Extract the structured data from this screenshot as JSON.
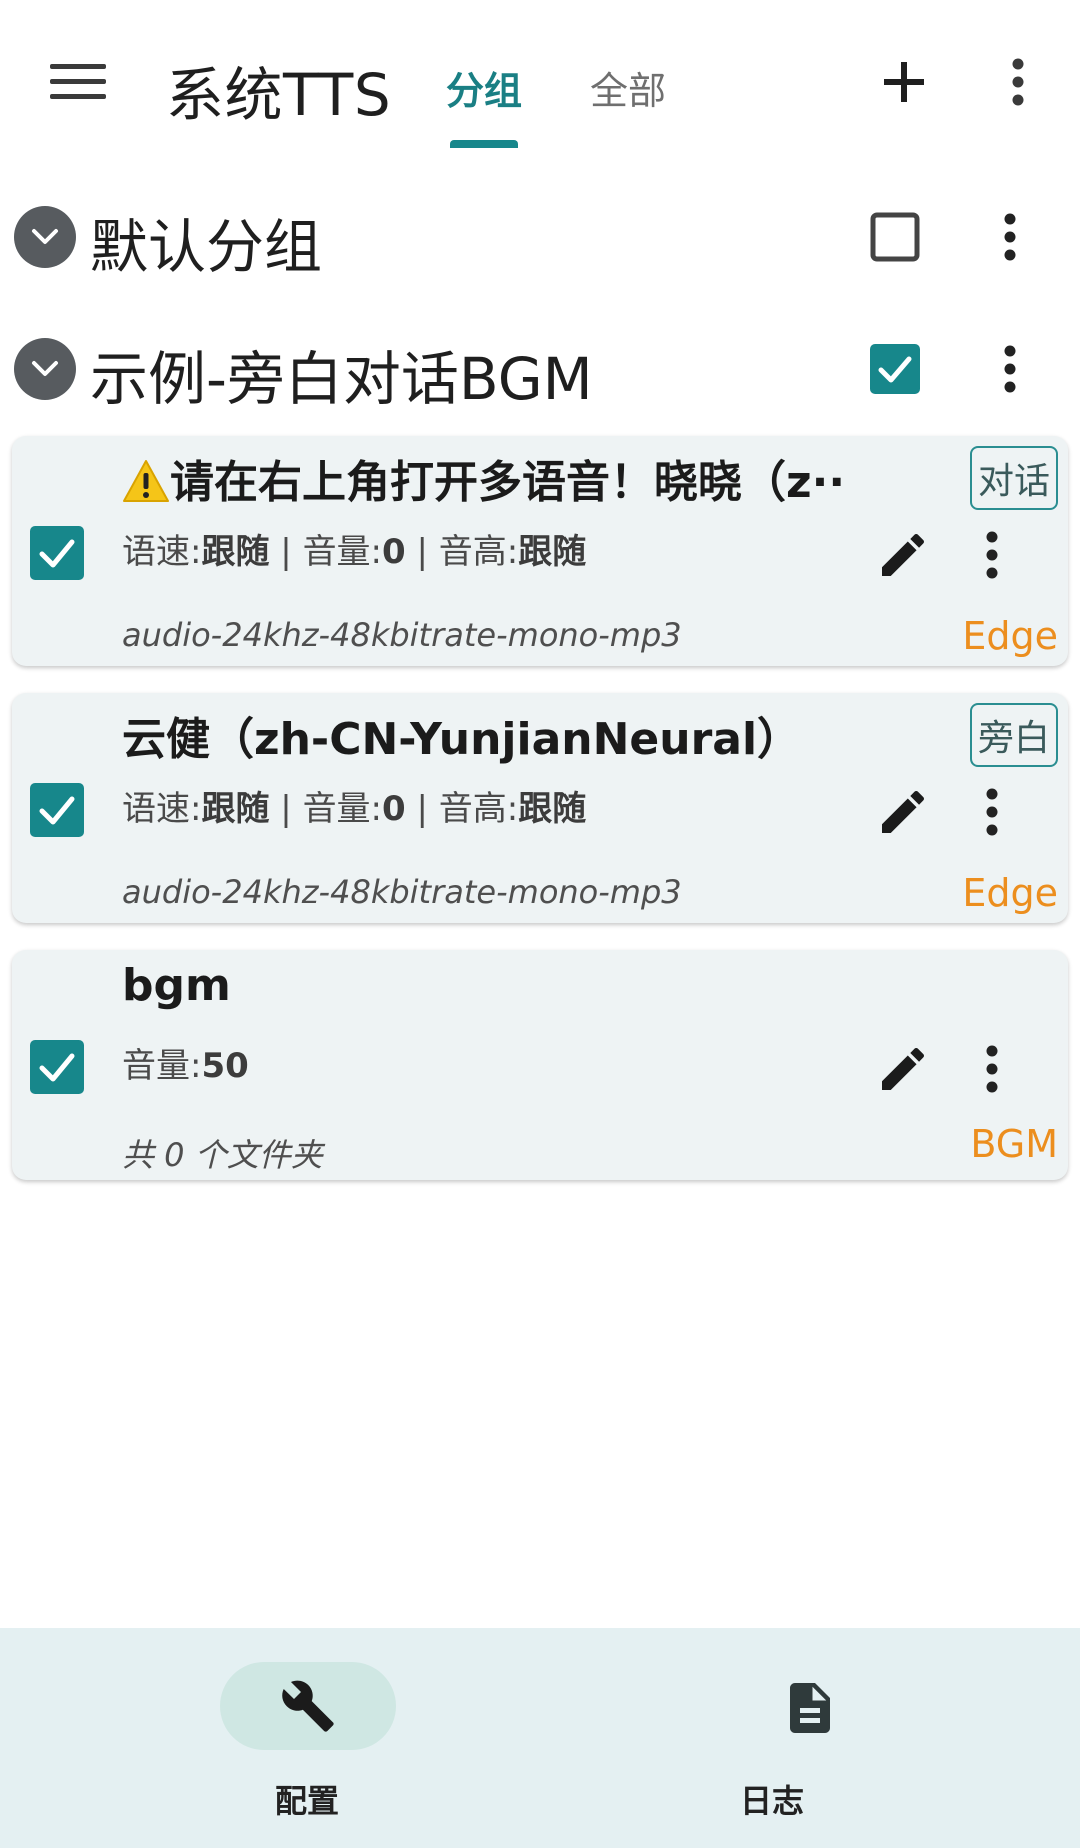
{
  "app": {
    "title": "系统TTS"
  },
  "tabs": [
    {
      "label": "分组",
      "selected": true
    },
    {
      "label": "全部",
      "selected": false
    }
  ],
  "icons": {
    "menu": "menu-icon",
    "add": "plus-icon",
    "more": "more-vert-icon",
    "expand": "chevron-down-icon",
    "edit": "pencil-icon",
    "config": "wrench-icon",
    "log": "document-icon",
    "warning": "warning-icon"
  },
  "colors": {
    "accent": "#17878b",
    "engine": "#ec8e1e",
    "card_bg": "#eef3f4",
    "nav_bg": "#e4f0f2"
  },
  "groups": [
    {
      "name": "默认分组",
      "checked": false
    },
    {
      "name": "示例-旁白对话BGM",
      "checked": true
    }
  ],
  "items": [
    {
      "title": "请在右上角打开多语音！晓晓（z··",
      "has_warning": true,
      "rate_label": "语速:",
      "rate_value": "跟随",
      "volume_label": "音量:",
      "volume_value": "0",
      "pitch_label": "音高:",
      "pitch_value": "跟随",
      "format": "audio-24khz-48kbitrate-mono-mp3",
      "role": "对话",
      "engine": "Edge",
      "checked": true
    },
    {
      "title": "云健（zh-CN-YunjianNeural）",
      "has_warning": false,
      "rate_label": "语速:",
      "rate_value": "跟随",
      "volume_label": "音量:",
      "volume_value": "0",
      "pitch_label": "音高:",
      "pitch_value": "跟随",
      "format": "audio-24khz-48kbitrate-mono-mp3",
      "role": "旁白",
      "engine": "Edge",
      "checked": true
    },
    {
      "title": "bgm",
      "volume_label": "音量:",
      "volume_value": "50",
      "format": "共 0 个文件夹",
      "engine": "BGM",
      "checked": true
    }
  ],
  "separator": "|",
  "bottom_nav": [
    {
      "label": "配置",
      "selected": true
    },
    {
      "label": "日志",
      "selected": false
    }
  ]
}
